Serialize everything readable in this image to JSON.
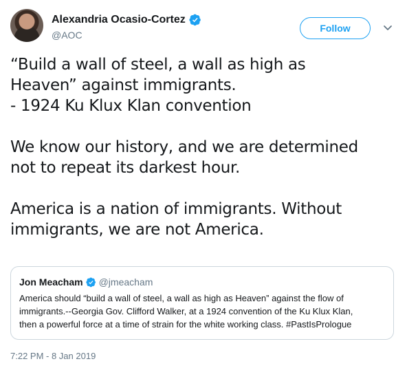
{
  "author": {
    "display_name": "Alexandria Ocasio-Cortez",
    "handle": "@AOC",
    "verified_icon": "verified-badge-icon"
  },
  "actions": {
    "follow_label": "Follow",
    "menu_icon": "chevron-down-icon"
  },
  "tweet": {
    "lines": [
      "“Build a wall of steel, a wall as high as",
      "Heaven” against immigrants.",
      "- 1924 Ku Klux Klan convention",
      "We know our history, and we are determined",
      "not to repeat its darkest hour.",
      "America is a nation of immigrants. Without",
      "immigrants, we are not America."
    ]
  },
  "quoted_tweet": {
    "display_name": "Jon Meacham",
    "handle": "@jmeacham",
    "lines": [
      "America should “build a wall of steel, a wall as high as Heaven” against the flow of",
      "immigrants.--Georgia Gov. Clifford Walker, at a 1924 convention of the Ku Klux Klan,",
      "then a powerful force at a time of strain for the white working class. #PastIsPrologue"
    ]
  },
  "timestamp": "7:22 PM - 8 Jan 2019",
  "colors": {
    "accent": "#1da1f2",
    "secondary_text": "#657786",
    "primary_text": "#14171a",
    "border": "#ccd6dd"
  }
}
